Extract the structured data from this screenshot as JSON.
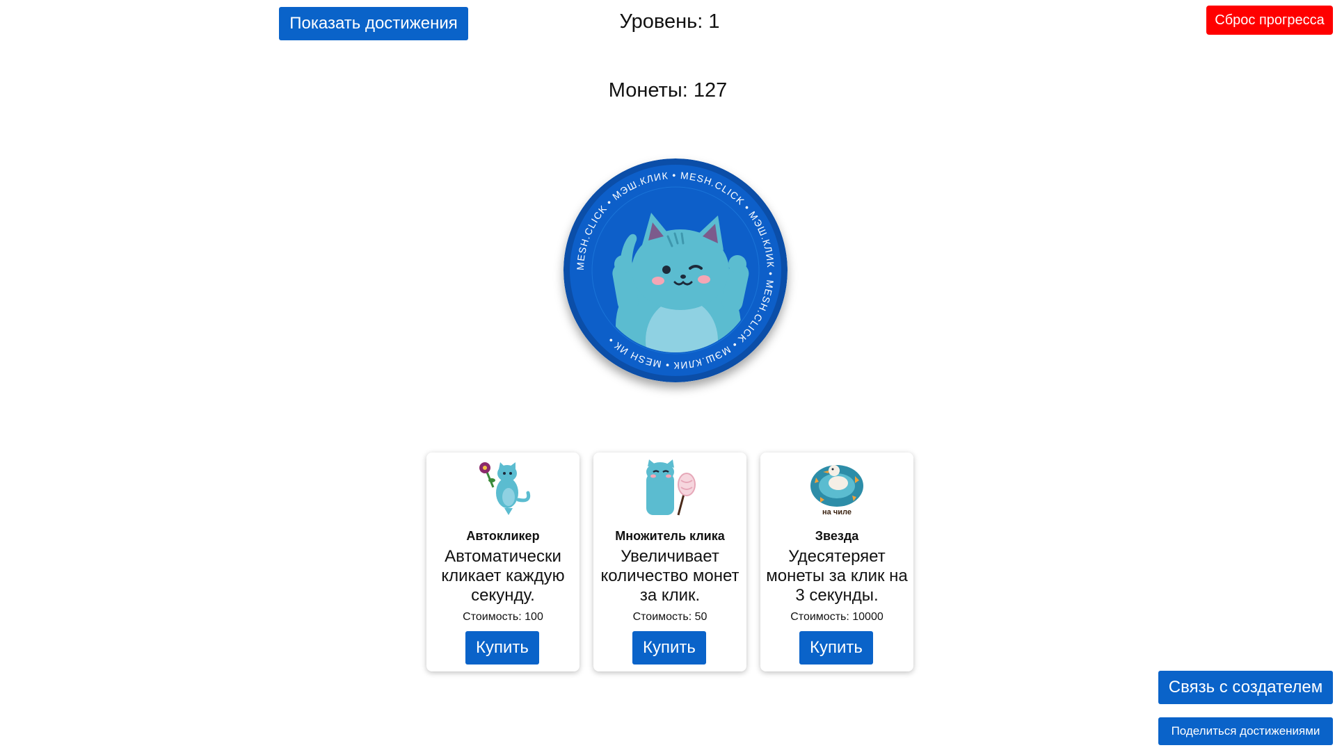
{
  "header": {
    "show_achievements_label": "Показать достижения",
    "level_text": "Уровень: 1",
    "reset_label": "Сброс прогресса"
  },
  "stats": {
    "coins_text": "Монеты: 127"
  },
  "coin": {
    "ring_text": "MESH.CLICK • МЭШ.КЛИК • MESH.CLICK • МЭШ.КЛИК • MESH.CLICK • МЭШ.КЛИК • MESH ИК • ",
    "icon": "blue-cat-thumbs-up-icon"
  },
  "shop": [
    {
      "icon": "cat-with-flower-icon",
      "name": "Автокликер",
      "description": "Автоматически кликает каждую секунду.",
      "cost": "Стоимость: 100",
      "buy_label": "Купить"
    },
    {
      "icon": "cat-with-lollipop-icon",
      "name": "Множитель клика",
      "description": "Увеличивает количество монет за клик.",
      "cost": "Стоимость: 50",
      "buy_label": "Купить"
    },
    {
      "icon": "duck-in-float-icon",
      "name": "Звезда",
      "description": "Удесятеряет монеты за клик на 3 секунды.",
      "cost": "Стоимость: 10000",
      "buy_label": "Купить",
      "caption": "на чиле"
    }
  ],
  "footer": {
    "contact_label": "Связь с создателем",
    "share_label": "Поделиться достижениями"
  },
  "colors": {
    "primary": "#0a63c9",
    "danger": "#ff0000",
    "coin_blue": "#0d5fc9",
    "cat_teal": "#5bbcd0"
  }
}
